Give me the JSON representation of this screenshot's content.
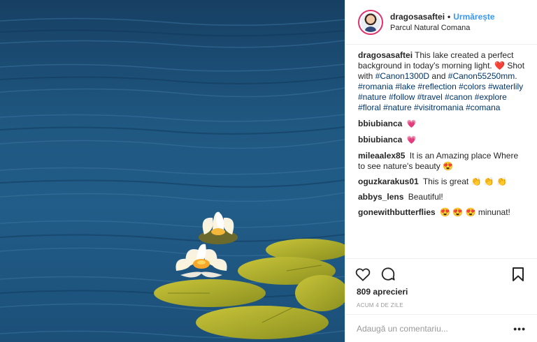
{
  "post": {
    "username": "dragosasaftei",
    "follow_label": "Urmărește",
    "location": "Parcul Natural Comana",
    "caption": {
      "text": "This lake created a perfect background in today's morning light. ❤️ Shot with ",
      "tag1": "#Canon1300D",
      "and": " and ",
      "tag2": "#Canon55250mm",
      "period": ".",
      "hashtags": "#romania #lake #reflection #colors #waterlily #nature #follow #travel #canon #explore #floral #nature #visitromania #comana"
    },
    "comments": [
      {
        "user": "bbiubianca",
        "text": "💗"
      },
      {
        "user": "bbiubianca",
        "text": "💗"
      },
      {
        "user": "mileaalex85",
        "text": "It is an Amazing place Where to see nature's beauty 😍"
      },
      {
        "user": "oguzkarakus01",
        "text": "This is great 👏 👏 👏"
      },
      {
        "user": "abbys_lens",
        "text": "Beautiful!"
      },
      {
        "user": "gonewithbutterflies",
        "text": "😍 😍 😍  minunat!"
      }
    ],
    "likes": "809 aprecieri",
    "time": "ACUM 4 DE ZILE",
    "comment_placeholder": "Adaugă un comentariu...",
    "more_label": "•••"
  },
  "icons": {
    "like": "heart-icon",
    "comment": "comment-icon",
    "save": "bookmark-icon",
    "more": "more-icon"
  }
}
